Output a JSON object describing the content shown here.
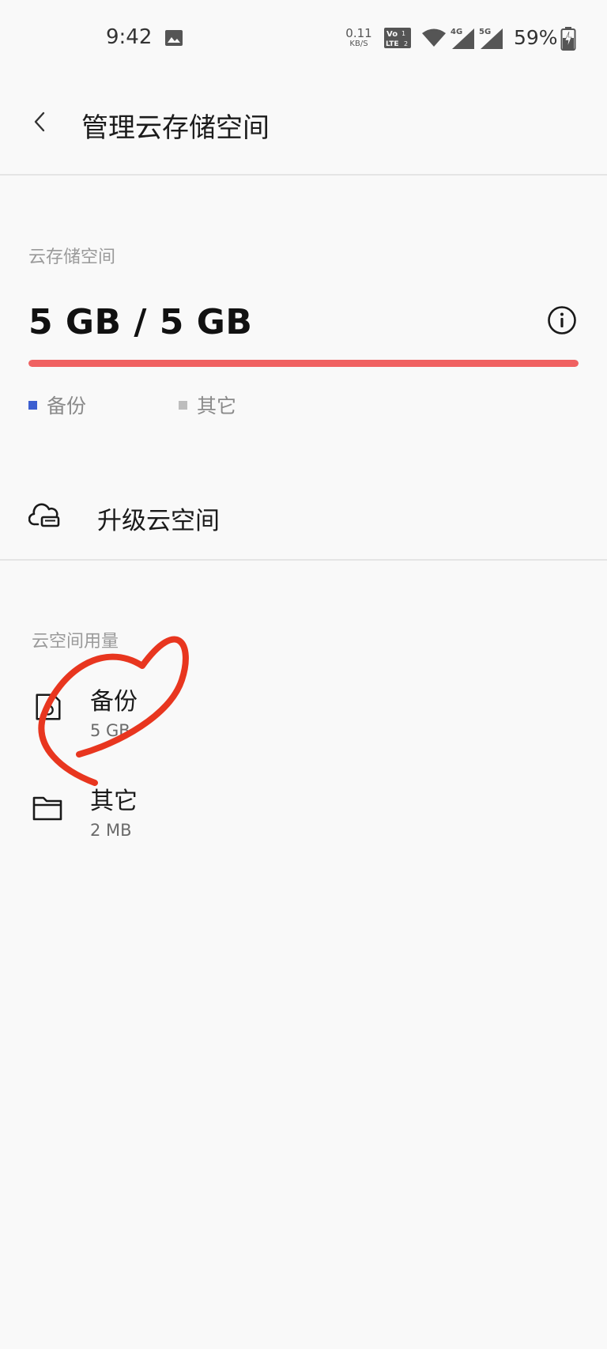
{
  "status_bar": {
    "time": "9:42",
    "net_speed_value": "0.11",
    "net_speed_unit": "KB/S",
    "battery": "59%"
  },
  "header": {
    "title": "管理云存储空间"
  },
  "storage": {
    "section_label": "云存储空间",
    "amount": "5 GB / 5 GB",
    "used_fraction": 1.0,
    "bar_color": "#f06161",
    "legend": [
      {
        "label": "备份",
        "color": "#3d5fd0"
      },
      {
        "label": "其它",
        "color": "#bdbdbd"
      }
    ]
  },
  "upgrade": {
    "label": "升级云空间"
  },
  "usage": {
    "section_label": "云空间用量",
    "items": [
      {
        "name": "备份",
        "size": "5 GB",
        "icon": "backup-icon"
      },
      {
        "name": "其它",
        "size": "2 MB",
        "icon": "folder-icon"
      }
    ]
  },
  "annotation_color": "#e8361f"
}
